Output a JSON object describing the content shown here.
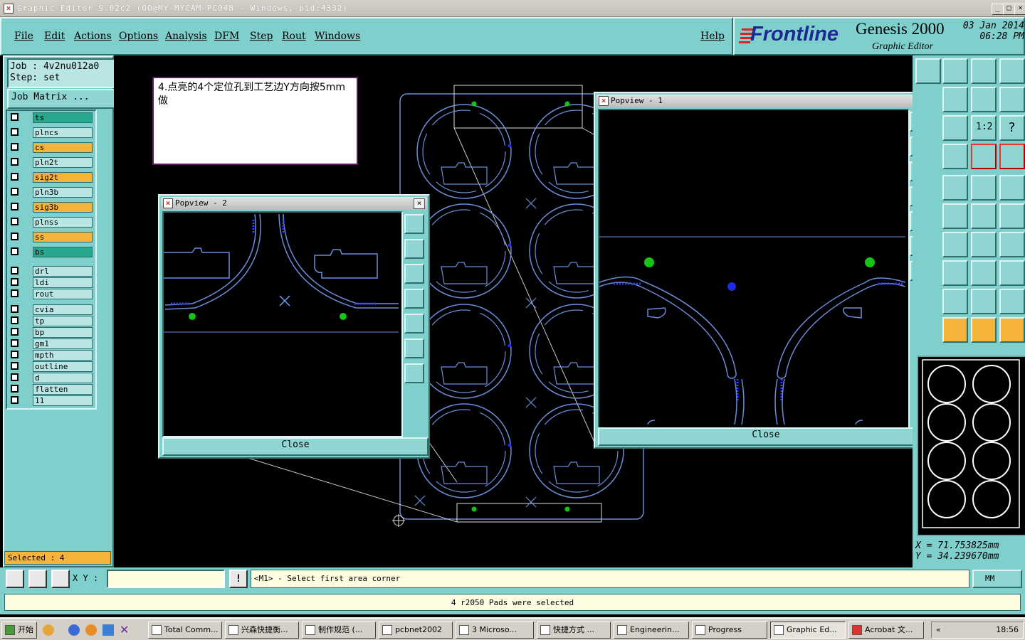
{
  "window": {
    "title": "Graphic Editor 9.02c2 (OO@MY-MYCAM-PC048 - Windows, pid:4332)"
  },
  "menu": [
    "File",
    "Edit",
    "Actions",
    "Options",
    "Analysis",
    "DFM",
    "Step",
    "Rout",
    "Windows"
  ],
  "help": "Help",
  "brand": {
    "logo": "Frontline",
    "product": "Genesis 2000",
    "subtitle": "Graphic Editor",
    "date": "03 Jan 2014",
    "time": "06:28 PM"
  },
  "job": {
    "job_label": "Job : 4v2nu012a0",
    "step_label": "Step: set",
    "matrix_button": "Job Matrix ..."
  },
  "layers": [
    {
      "name": "ts",
      "color": "#27a88d"
    },
    {
      "name": "plncs",
      "color": "#b9e6e4"
    },
    {
      "name": "cs",
      "color": "#f5b33a"
    },
    {
      "name": "pln2t",
      "color": "#b9e6e4"
    },
    {
      "name": "sig2t",
      "color": "#f5b33a"
    },
    {
      "name": "pln3b",
      "color": "#b9e6e4"
    },
    {
      "name": "sig3b",
      "color": "#f5b33a"
    },
    {
      "name": "plnss",
      "color": "#b9e6e4"
    },
    {
      "name": "ss",
      "color": "#f5b33a"
    },
    {
      "name": "bs",
      "color": "#27a88d"
    },
    {
      "name": "drl",
      "color": "#b9e6e4"
    },
    {
      "name": "ldi",
      "color": "#b9e6e4"
    },
    {
      "name": "rout",
      "color": "#b9e6e4"
    },
    {
      "name": "cvia",
      "color": "#b9e6e4"
    },
    {
      "name": "tp",
      "color": "#b9e6e4"
    },
    {
      "name": "bp",
      "color": "#b9e6e4"
    },
    {
      "name": "gm1",
      "color": "#b9e6e4"
    },
    {
      "name": "mpth",
      "color": "#b9e6e4"
    },
    {
      "name": "outline",
      "color": "#b9e6e4"
    },
    {
      "name": "d",
      "color": "#b9e6e4"
    },
    {
      "name": "flatten",
      "color": "#b9e6e4"
    },
    {
      "name": "11",
      "color": "#b9e6e4"
    }
  ],
  "selected": "Selected : 4",
  "note": "4.点亮的4个定位孔到工艺边Y方向按5mm做",
  "popview2": {
    "title": "Popview - 2",
    "close": "Close"
  },
  "popview1": {
    "title": "Popview - 1",
    "close": "Close"
  },
  "coords": {
    "x": "X = 71.753825mm",
    "y": "Y = 34.239670mm"
  },
  "cmd": {
    "xy_label": "X Y :",
    "xy_value": "",
    "bang": "!",
    "prompt": "<M1> - Select first area corner",
    "units": "MM"
  },
  "status": "4 r2050 Pads were selected",
  "taskbar": {
    "start": "开始",
    "tasks": [
      "Total Comm...",
      "兴森快捷衡...",
      "制作规范 (...",
      "pcbnet2002",
      "3 Microso...",
      "快捷方式 ...",
      "Engineerin...",
      "Progress",
      "Graphic Ed...",
      "Acrobat 文..."
    ],
    "clock": "18:56"
  },
  "colors": {
    "accent": "#7fcfcc",
    "pcb_line": "#6b8cd8",
    "pad_green": "#16c416",
    "pad_blue": "#1a2ee8"
  }
}
